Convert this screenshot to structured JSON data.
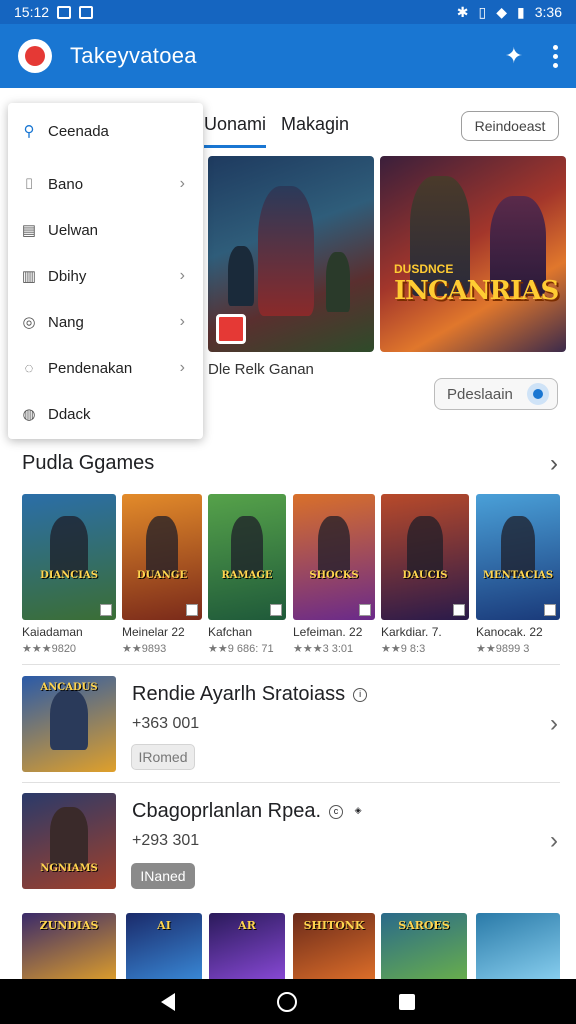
{
  "status_bar": {
    "time_left": "15:12",
    "time_right": "3:36"
  },
  "app_bar": {
    "title": "Takeyvatoea",
    "pin_icon": "pin-icon",
    "menu_icon": "more-vert-icon"
  },
  "tabs": [
    {
      "label": "Uonami",
      "active": true
    },
    {
      "label": "Makagin",
      "active": false
    }
  ],
  "tab_action_label": "Reindoeast",
  "dropdown_menu": [
    {
      "label": "Ceenada",
      "icon": "search-icon",
      "chevron": false
    },
    {
      "label": "Bano",
      "icon": "bookmark-icon",
      "chevron": true
    },
    {
      "label": "Uelwan",
      "icon": "document-icon",
      "chevron": false
    },
    {
      "label": "Dbihy",
      "icon": "grid-icon",
      "chevron": true
    },
    {
      "label": "Nang",
      "icon": "settings-icon",
      "chevron": true
    },
    {
      "label": "Pendenakan",
      "icon": "chat-icon",
      "chevron": true
    },
    {
      "label": "Ddack",
      "icon": "feedback-icon",
      "chevron": false
    }
  ],
  "featured": {
    "banner_title": "INCANRIAS",
    "banner_subtitle": "DUSDNCE",
    "caption": "Dle Relk Ganan",
    "pill_label": "Pdeslaain"
  },
  "section": {
    "title": "Pudla Ggames"
  },
  "game_cards": [
    {
      "label": "Kaiadaman",
      "rating": "★★★9820",
      "card_title": "DIANCIAS",
      "colors": [
        "#3b6e35",
        "#2b6ea8"
      ]
    },
    {
      "label": "Meinelar  22",
      "rating": "★★9893",
      "card_title": "DUANGE",
      "colors": [
        "#7a2a1a",
        "#e38b2a"
      ]
    },
    {
      "label": "Kafchan",
      "rating": "★★9 686: 71",
      "card_title": "RAMAGE",
      "colors": [
        "#1f5a3a",
        "#56a24a"
      ]
    },
    {
      "label": "Lefeiman.  22",
      "rating": "★★★3 3:01",
      "card_title": "SHOCKS",
      "colors": [
        "#6a2a8a",
        "#d9702a"
      ]
    },
    {
      "label": "Karkdiar.  7.",
      "rating": "★★9 8:3",
      "card_title": "DAUCIS",
      "colors": [
        "#2a1a4a",
        "#b84a2a"
      ]
    },
    {
      "label": "Kanocak.  22",
      "rating": "★★9899 3",
      "card_title": "MENTACIAS",
      "colors": [
        "#1a3a7a",
        "#4aa0d8"
      ]
    }
  ],
  "list_items": [
    {
      "title": "Rendie Ayarlh Sratoiass",
      "sub": "+363 001",
      "button": "IRomed",
      "btn_style": "light",
      "thumb_title": "ANCADUS",
      "colors": [
        "#2a5aa8",
        "#e0a02a"
      ]
    },
    {
      "title": "Cbagoprlanlan Rpea.",
      "sub": "+293 301",
      "button": "INaned",
      "btn_style": "dark",
      "thumb_title": "NGNIAMS",
      "colors": [
        "#2a3a6a",
        "#a0402a"
      ]
    }
  ],
  "bottom_row": [
    {
      "title": "ZUNDIAS",
      "colors": [
        "#3a2a6a",
        "#e0a02a"
      ]
    },
    {
      "title": "AI",
      "colors": [
        "#1a2a6a",
        "#3a8ad8"
      ]
    },
    {
      "title": "AR",
      "colors": [
        "#2a1a5a",
        "#8a4ad8"
      ]
    },
    {
      "title": "SHITONK",
      "colors": [
        "#6a2a1a",
        "#e0702a"
      ]
    },
    {
      "title": "SAROES",
      "colors": [
        "#2a6a8a",
        "#6ab04a"
      ]
    },
    {
      "title": "",
      "colors": [
        "#2a7aa8",
        "#8ad0f0"
      ]
    }
  ]
}
